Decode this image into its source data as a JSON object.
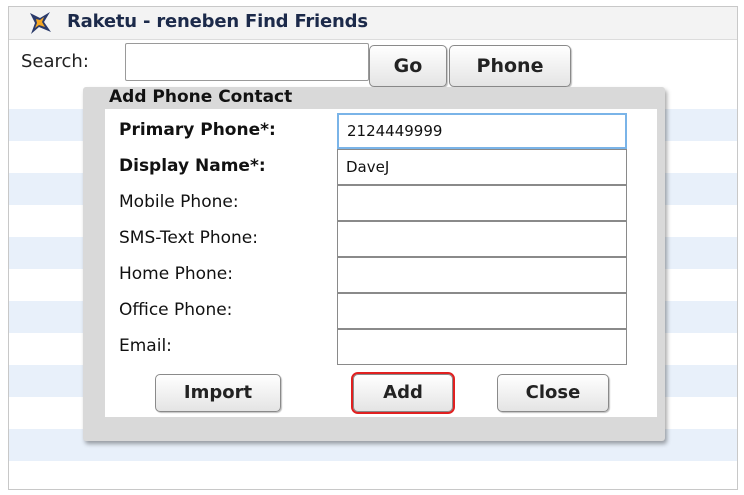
{
  "window": {
    "title": "Raketu - reneben Find Friends",
    "icon": "raketu-logo-icon"
  },
  "search": {
    "label": "Search:",
    "value": "",
    "go_label": "Go",
    "phone_label": "Phone"
  },
  "dialog": {
    "title": "Add Phone Contact",
    "fields": [
      {
        "label": "Primary Phone*:",
        "value": "2124449999",
        "required": true,
        "focused": true
      },
      {
        "label": "Display Name*:",
        "value": "DaveJ",
        "required": true
      },
      {
        "label": "Mobile Phone:",
        "value": ""
      },
      {
        "label": "SMS-Text Phone:",
        "value": ""
      },
      {
        "label": "Home Phone:",
        "value": ""
      },
      {
        "label": "Office Phone:",
        "value": ""
      },
      {
        "label": "Email:",
        "value": ""
      }
    ],
    "buttons": {
      "import_label": "Import",
      "add_label": "Add",
      "close_label": "Close"
    }
  },
  "colors": {
    "title_text": "#1c2a4a",
    "stripe": "#e8f0fa",
    "focus_border": "#7ab4e8",
    "highlight": "#e02020"
  }
}
